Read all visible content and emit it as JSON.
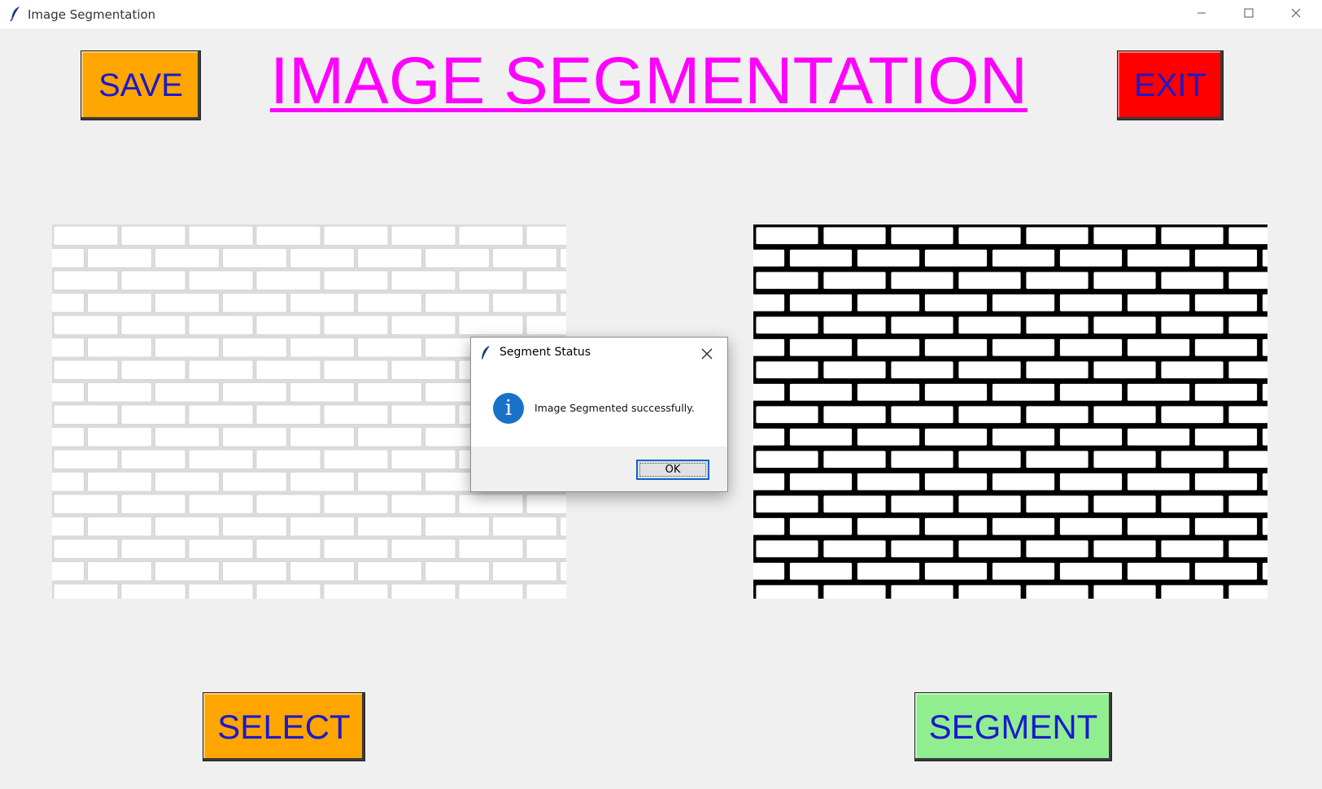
{
  "window": {
    "title": "Image Segmentation",
    "icon": "feather-icon"
  },
  "header": {
    "title": "IMAGE SEGMENTATION",
    "title_color": "#ff00ff",
    "save_label": "SAVE",
    "save_color": "#ffa500",
    "exit_label": "EXIT",
    "exit_color": "#ff0000",
    "button_text_color": "#1a1acc"
  },
  "images": {
    "original": {
      "description_icon": "brick-wall-image",
      "tone": "light"
    },
    "segmented": {
      "description_icon": "brick-wall-segmented-image",
      "tone": "binary"
    }
  },
  "footer": {
    "select_label": "SELECT",
    "select_color": "#ffa500",
    "segment_label": "SEGMENT",
    "segment_color": "#90ee90"
  },
  "dialog": {
    "title": "Segment Status",
    "message": "Image Segmented successfully.",
    "ok_label": "OK",
    "icon": "info-icon",
    "info_symbol": "i"
  }
}
